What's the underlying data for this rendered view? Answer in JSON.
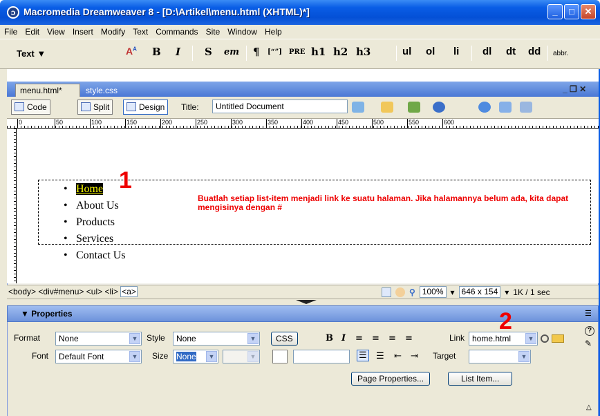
{
  "window": {
    "title": "Macromedia Dreamweaver 8 - [D:\\Artikel\\menu.html (XHTML)*]",
    "app_icon": "dreamweaver-icon",
    "controls": {
      "minimize": "_",
      "maximize": "□",
      "close": "✕"
    }
  },
  "menubar": [
    "File",
    "Edit",
    "View",
    "Insert",
    "Modify",
    "Text",
    "Commands",
    "Site",
    "Window",
    "Help"
  ],
  "insertbar": {
    "category": "Text ▼",
    "buttons": [
      "B",
      "I",
      "S",
      "em",
      "¶",
      "[“”]",
      "PRE",
      "h1",
      "h2",
      "h3",
      "ul",
      "ol",
      "li",
      "dl",
      "dt",
      "dd",
      "abbr."
    ]
  },
  "document": {
    "tabs": [
      {
        "label": "menu.html*",
        "active": true
      },
      {
        "label": "style.css",
        "active": false
      }
    ],
    "window_controls": "_ ❐ ✕",
    "views": [
      "Code",
      "Split",
      "Design"
    ],
    "title_label": "Title:",
    "title_value": "Untitled Document",
    "ruler_ticks": [
      "0",
      "50",
      "100",
      "150",
      "200",
      "250",
      "300",
      "350",
      "400",
      "450",
      "500",
      "550",
      "600"
    ],
    "menu_items": [
      "Home",
      "About Us",
      "Products",
      "Services",
      "Contact Us"
    ],
    "annotation_1": "1",
    "annotation_text": "Buatlah setiap list-item menjadi link ke suatu halaman. Jika halamannya belum ada, kita dapat mengisinya dengan #"
  },
  "statusbar": {
    "tags": [
      "<body>",
      "<div#menu>",
      "<ul>",
      "<li>"
    ],
    "active_tag": "<a>",
    "zoom": "100%",
    "window_size": "646 x 154",
    "download": "1K / 1 sec"
  },
  "properties": {
    "title": "▼ Properties",
    "format_label": "Format",
    "format_value": "None",
    "style_label": "Style",
    "style_value": "None",
    "css_button": "CSS",
    "font_label": "Font",
    "font_value": "Default Font",
    "size_label": "Size",
    "size_value": "None",
    "link_label": "Link",
    "link_value": "home.html",
    "target_label": "Target",
    "target_value": "",
    "page_properties_button": "Page Properties...",
    "list_item_button": "List Item...",
    "annotation_2": "2",
    "colors": {
      "annotation": "#e00000",
      "titlebar": "#0a5ee6"
    }
  }
}
